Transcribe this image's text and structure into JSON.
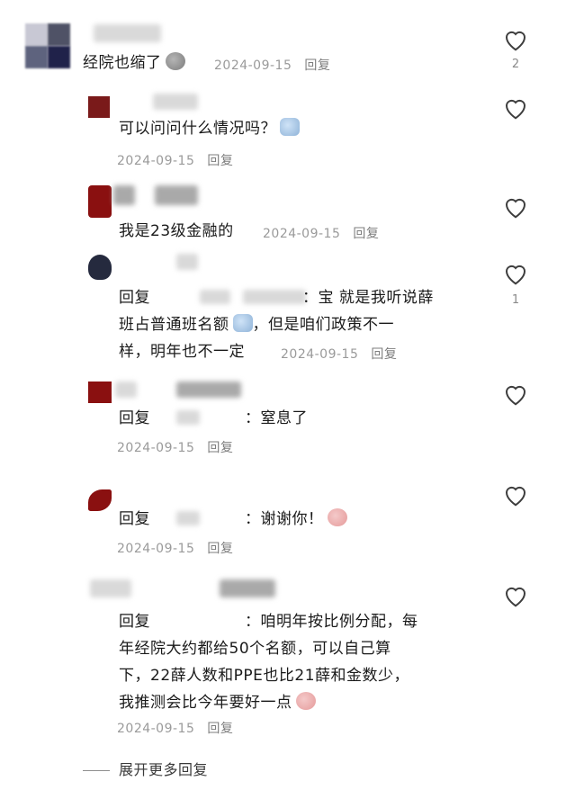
{
  "comments": [
    {
      "id": "c1",
      "text": "经院也缩了",
      "date": "2024-09-15",
      "reply": "回复",
      "likes": "2"
    },
    {
      "id": "c2",
      "text": "可以问问什么情况吗？",
      "date": "2024-09-15",
      "reply": "回复",
      "likes": ""
    },
    {
      "id": "c3",
      "text": "我是23级金融的",
      "date": "2024-09-15",
      "reply": "回复",
      "likes": ""
    },
    {
      "id": "c4",
      "prefix": "回复",
      "colon": "：",
      "lines": [
        "宝 就是我听说薛",
        "班占普通班名额",
        "，但是咱们政策不一",
        "样，明年也不一定"
      ],
      "date": "2024-09-15",
      "reply": "回复",
      "likes": "1"
    },
    {
      "id": "c5",
      "prefix": "回复",
      "colon": "：",
      "text": "窒息了",
      "date": "2024-09-15",
      "reply": "回复",
      "likes": ""
    },
    {
      "id": "c6",
      "prefix": "回复",
      "colon": "：",
      "text": "谢谢你！",
      "date": "2024-09-15",
      "reply": "回复",
      "likes": ""
    },
    {
      "id": "c7",
      "prefix": "回复",
      "colon": "：",
      "lines": [
        "咱明年按比例分配，每",
        "年经院大约都给50个名额，可以自己算",
        "下，22薛人数和PPE也比21薛和金数少，",
        "我推测会比今年要好一点"
      ],
      "date": "2024-09-15",
      "reply": "回复",
      "likes": ""
    }
  ],
  "expand_more": "展开更多回复",
  "colors": {
    "heart": "#3d3d3d",
    "meta": "#9a9a9a",
    "text": "#1a1a1a"
  }
}
